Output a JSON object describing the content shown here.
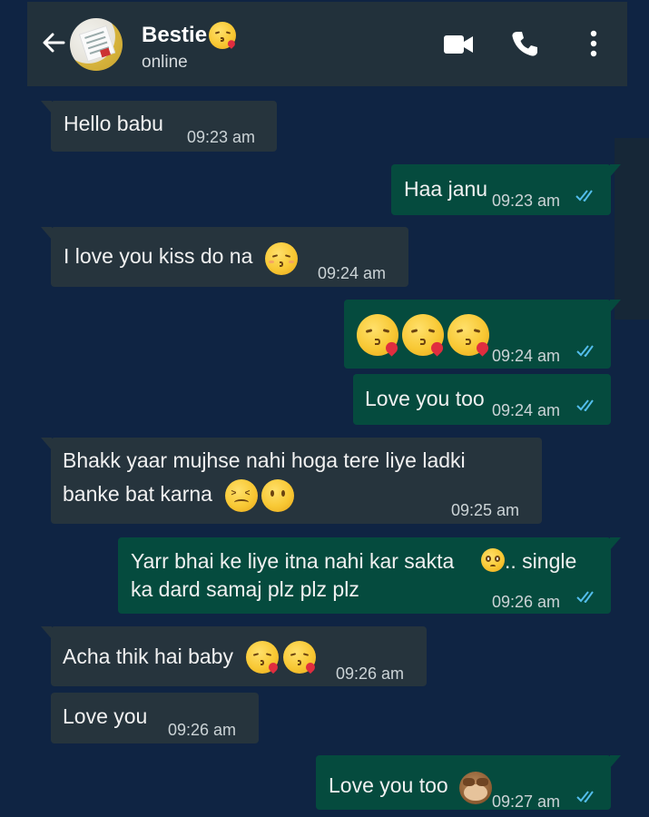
{
  "header": {
    "contact_name": "Bestie",
    "status": "online",
    "icons": [
      "back-arrow-icon",
      "video-call-icon",
      "voice-call-icon",
      "more-options-icon"
    ]
  },
  "colors": {
    "background": "#0f2443",
    "header": "#22313b",
    "incoming_bubble": "#26343d",
    "outgoing_bubble": "#054b3e",
    "read_ticks": "#53bdeb"
  },
  "messages": [
    {
      "direction": "incoming",
      "text": "Hello babu",
      "time": "09:23 am"
    },
    {
      "direction": "outgoing",
      "text": "Haa janu",
      "time": "09:23 am",
      "read": true
    },
    {
      "direction": "incoming",
      "text": "I love you kiss do na",
      "emoji": [
        "kissing-closed-eyes-emoji"
      ],
      "time": "09:24 am"
    },
    {
      "direction": "outgoing",
      "text": "",
      "emoji": [
        "face-blowing-kiss-emoji",
        "face-blowing-kiss-emoji",
        "face-blowing-kiss-emoji"
      ],
      "time": "09:24 am",
      "read": true
    },
    {
      "direction": "outgoing",
      "text": "Love you too",
      "time": "09:24 am",
      "read": true
    },
    {
      "direction": "incoming",
      "lines": [
        "Bhakk yaar mujhse nahi hoga tere liye ladki",
        "banke bat karna"
      ],
      "emoji": [
        "confounded-face-emoji",
        "face-without-mouth-emoji"
      ],
      "time": "09:25 am"
    },
    {
      "direction": "outgoing",
      "lines": [
        "Yarr bhai ke liye itna nahi kar sakta",
        ".. single",
        "ka dard samaj plz plz plz"
      ],
      "emoji": [
        "pleading-face-emoji"
      ],
      "time": "09:26 am",
      "read": true
    },
    {
      "direction": "incoming",
      "text": "Acha thik hai baby",
      "emoji": [
        "face-blowing-kiss-emoji",
        "face-blowing-kiss-emoji"
      ],
      "time": "09:26 am"
    },
    {
      "direction": "incoming",
      "text": "Love you",
      "time": "09:26 am"
    },
    {
      "direction": "outgoing",
      "text": "Love you too",
      "emoji": [
        "see-no-evil-monkey-emoji"
      ],
      "time": "09:27 am",
      "read": true
    }
  ]
}
